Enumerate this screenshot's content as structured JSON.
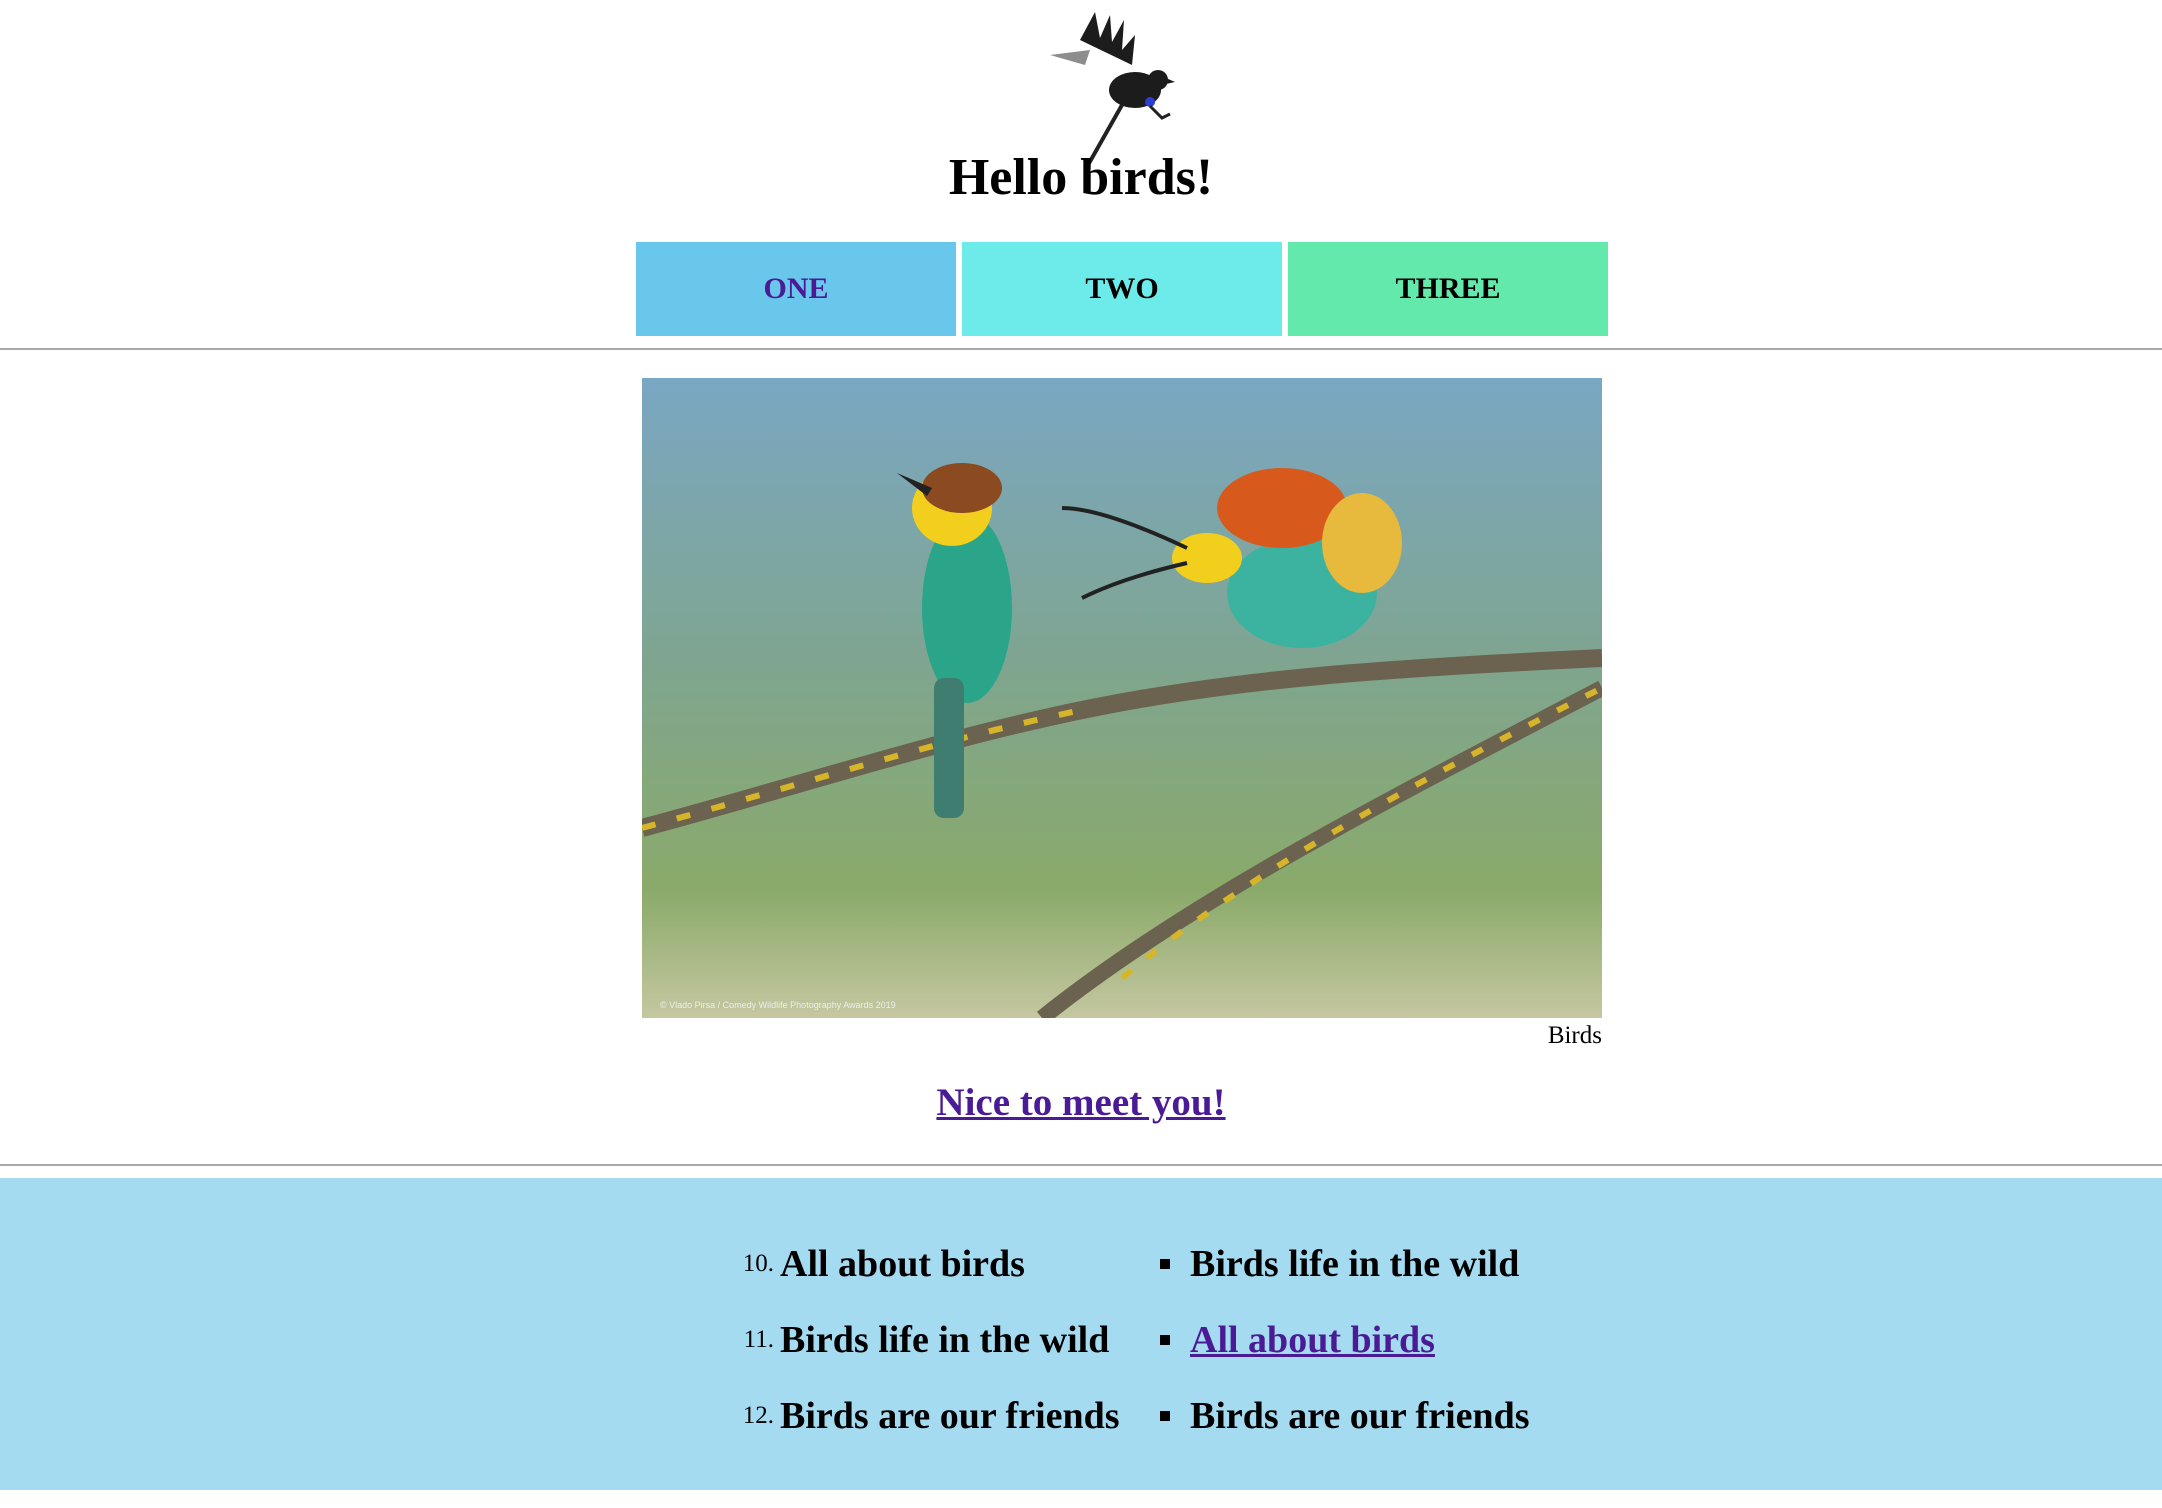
{
  "header": {
    "title": "Hello birds!"
  },
  "nav": {
    "items": [
      {
        "label": "ONE",
        "color": "#6ac7ec"
      },
      {
        "label": "TWO",
        "color": "#6deaea"
      },
      {
        "label": "THREE",
        "color": "#62e9ab"
      }
    ],
    "visited_link_color": "#4b1b96"
  },
  "figure": {
    "credit": "© Vlado Pirsa / Comedy Wildlife Photography Awards 2019",
    "caption": "Birds"
  },
  "greeting": {
    "text": "Nice to meet you!"
  },
  "footer": {
    "background": "#a5dbf1",
    "ordered_list": [
      {
        "number": "10.",
        "text": "All about birds"
      },
      {
        "number": "11.",
        "text": "Birds life in the wild"
      },
      {
        "number": "12.",
        "text": "Birds are our friends"
      }
    ],
    "unordered_list": [
      {
        "text": "Birds life in the wild"
      },
      {
        "text": "All about birds",
        "is_link": true
      },
      {
        "text": "Birds are our friends"
      }
    ]
  }
}
